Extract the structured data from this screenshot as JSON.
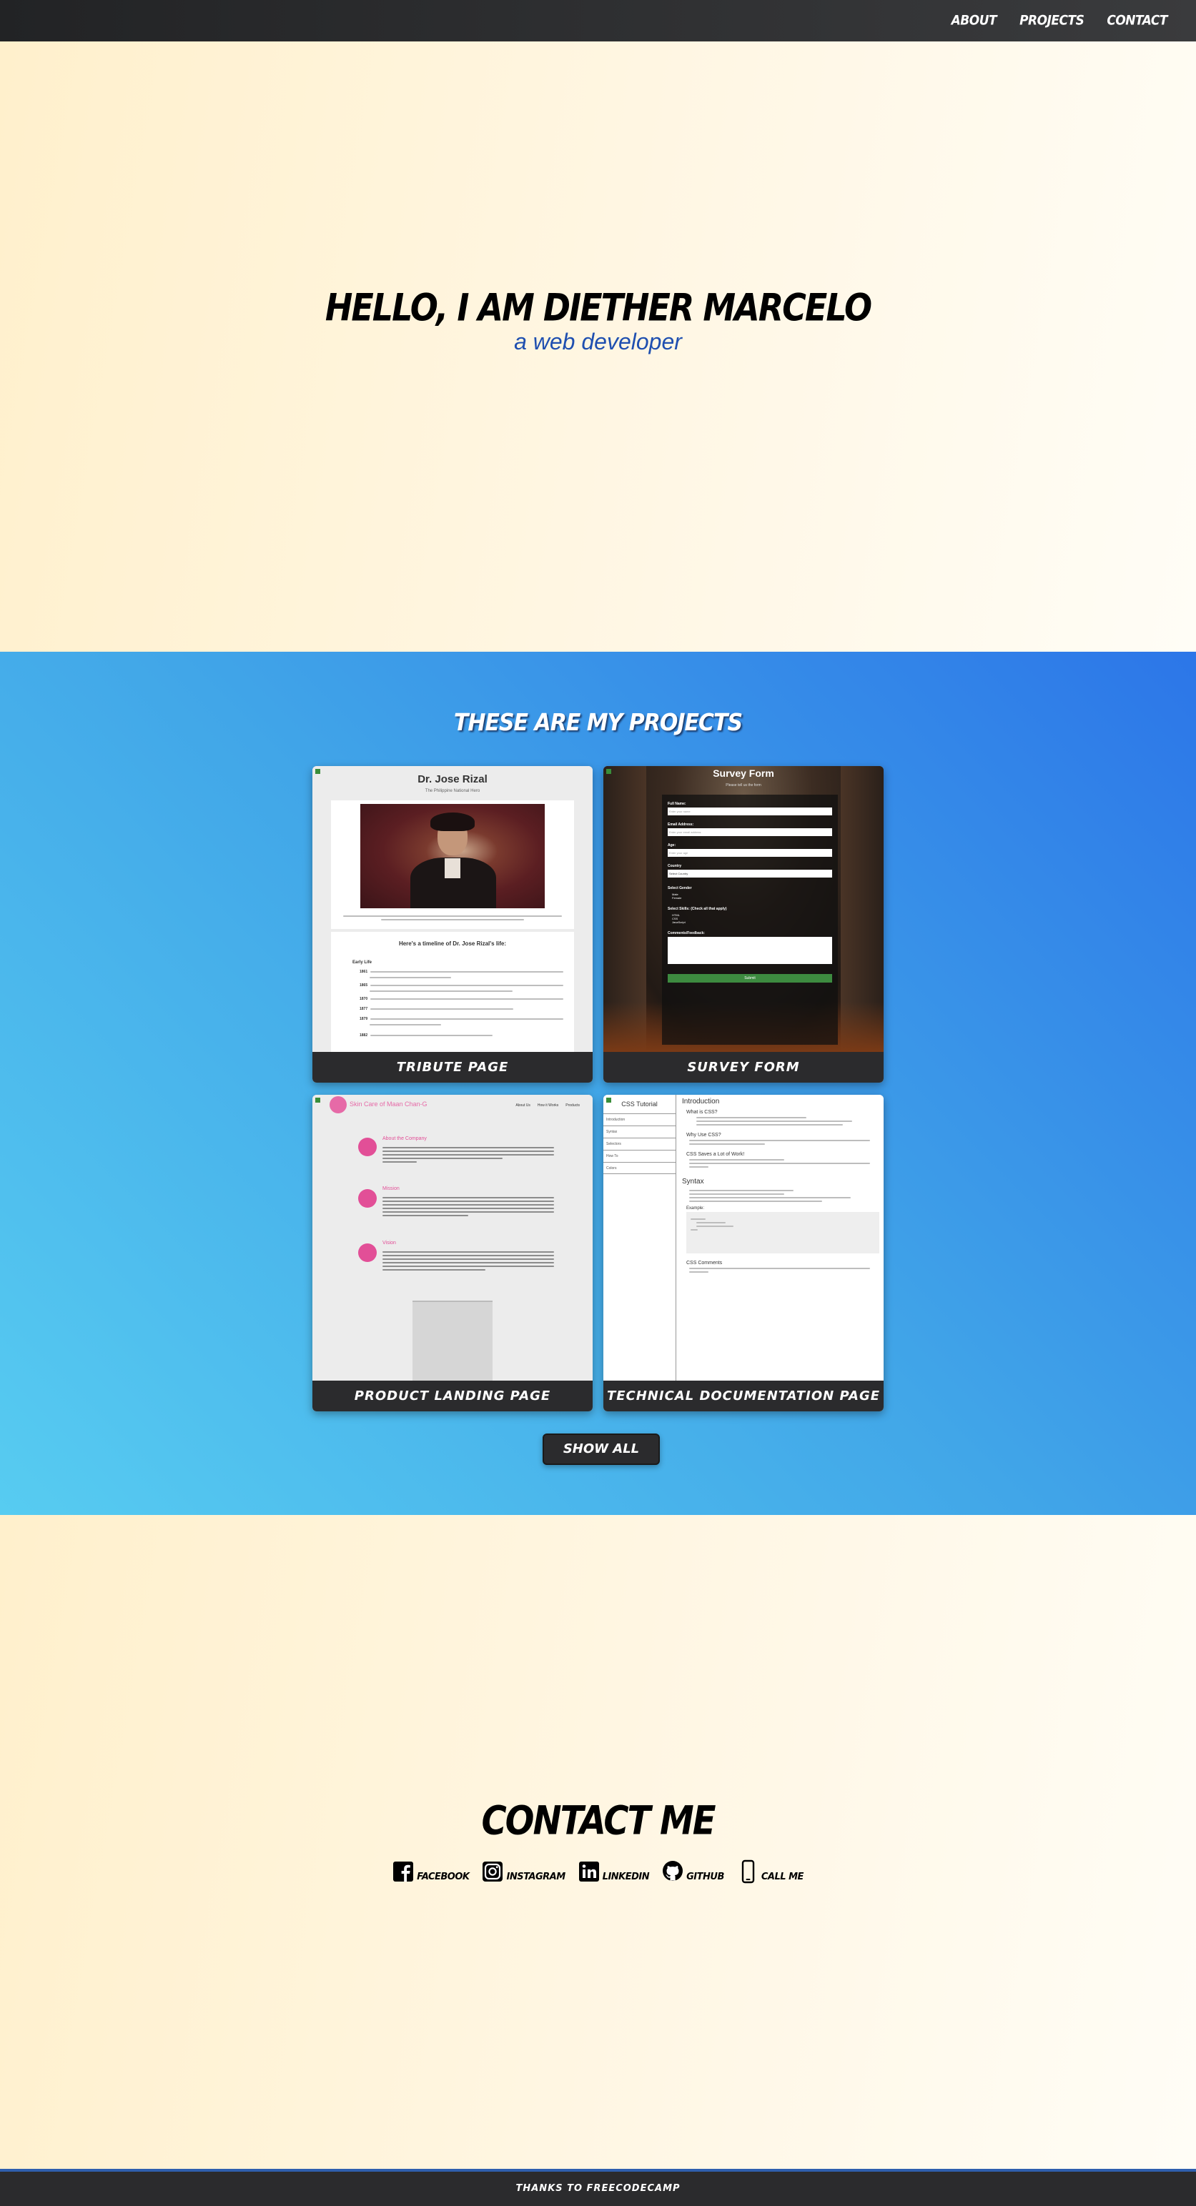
{
  "nav": {
    "items": [
      "ABOUT",
      "PROJECTS",
      "CONTACT"
    ]
  },
  "hero": {
    "title": "HELLO, I AM DIETHER MARCELO",
    "subtitle": "a web developer"
  },
  "projects": {
    "heading": "THESE ARE MY PROJECTS",
    "cards": [
      {
        "caption": "TRIBUTE PAGE",
        "title": "Dr. Jose Rizal",
        "subtitle": "The Philippine National Hero",
        "timeline_heading": "Here's a timeline of Dr. Jose Rizal's life:",
        "section": "Early Life",
        "years": [
          "1861",
          "1865",
          "1870",
          "1877",
          "1879",
          "1882"
        ]
      },
      {
        "caption": "SURVEY FORM",
        "title": "Survey Form",
        "subtitle": "Please tell us the form",
        "fields": [
          "Full Name:",
          "Email Address:",
          "Age:",
          "Country",
          "Select Gender",
          "Select Skills: (Check all that apply)",
          "Comments/Feedback:"
        ],
        "placeholders": [
          "Enter your name",
          "Enter your email address",
          "Enter your age"
        ],
        "country_value": "Select Country",
        "genders": [
          "Male",
          "Female"
        ],
        "skills": [
          "HTML",
          "CSS",
          "JavaScript"
        ],
        "submit": "Submit"
      },
      {
        "caption": "PRODUCT LANDING PAGE",
        "brand": "Skin Care of Maan Chan-G",
        "nav": [
          "About Us",
          "How it Works",
          "Products"
        ],
        "sections": [
          "About the Company",
          "Mission",
          "Vision"
        ]
      },
      {
        "caption": "TECHNICAL DOCUMENTATION PAGE",
        "sidebar_title": "CSS Tutorial",
        "sidebar_items": [
          "Introduction",
          "Syntax",
          "Selectors",
          "How To",
          "Colors"
        ],
        "h_intro": "Introduction",
        "q1": "What is CSS?",
        "q2": "Why Use CSS?",
        "q3": "CSS Saves a Lot of Work!",
        "h_syntax": "Syntax",
        "example": "Example:",
        "comments": "CSS Comments"
      }
    ],
    "show_all": "SHOW ALL"
  },
  "contact": {
    "heading": "CONTACT ME",
    "links": [
      {
        "label": "FACEBOOK",
        "icon": "facebook-icon"
      },
      {
        "label": "INSTAGRAM",
        "icon": "instagram-icon"
      },
      {
        "label": "LINKEDIN",
        "icon": "linkedin-icon"
      },
      {
        "label": "GITHUB",
        "icon": "github-icon"
      },
      {
        "label": "CALL ME",
        "icon": "phone-icon"
      }
    ]
  },
  "footer": {
    "text": "THANKS TO FREECODECAMP"
  },
  "colors": {
    "nav_bg": "#2b2b2d",
    "subtitle_blue": "#1f4fb0",
    "projects_blue_start": "#57ccf1",
    "projects_blue_end": "#2c76e8",
    "hero_cream": "#fff0cc"
  }
}
